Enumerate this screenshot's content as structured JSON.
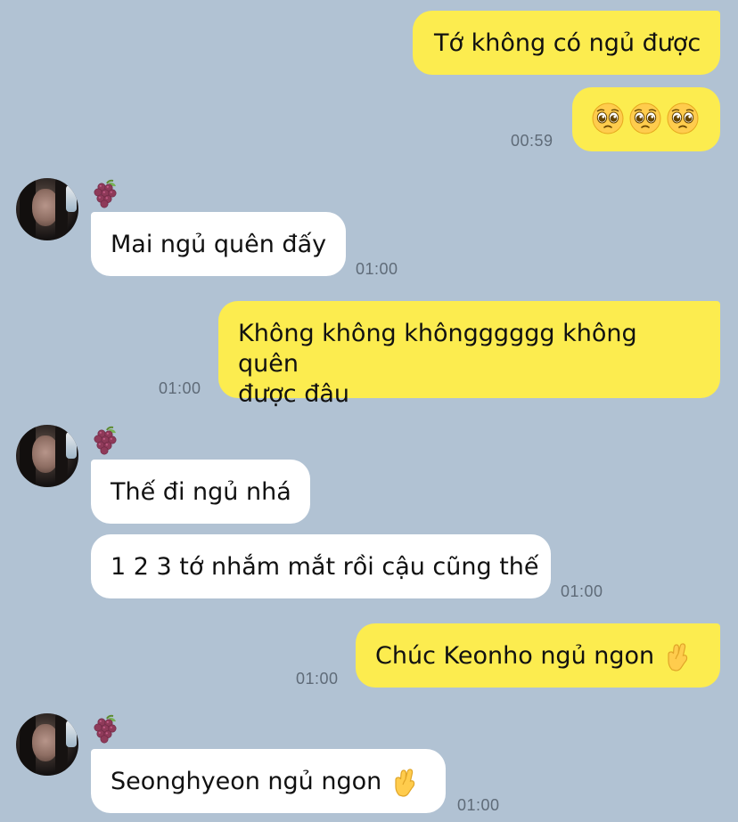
{
  "messages": [
    {
      "side": "me",
      "text": "Tớ không có ngủ được"
    },
    {
      "side": "me",
      "emoji": [
        "pleading-face-icon",
        "pleading-face-icon",
        "pleading-face-icon"
      ],
      "time": "00:59"
    },
    {
      "side": "them",
      "text": "Mai ngủ quên đấy",
      "time": "01:00"
    },
    {
      "side": "me",
      "line1": "Không không khôngggggg không quên",
      "line2": "được đâu",
      "time": "01:00"
    },
    {
      "side": "them",
      "text": "Thế đi ngủ nhá"
    },
    {
      "side": "them",
      "text": "1 2 3 tớ nhắm mắt rồi cậu cũng thế",
      "time": "01:00"
    },
    {
      "side": "me",
      "text": "Chúc Keonho ngủ ngon",
      "emoji": "crossed-fingers-icon",
      "time": "01:00"
    },
    {
      "side": "them",
      "text": "Seonghyeon ngủ ngon",
      "emoji": "crossed-fingers-icon",
      "time": "01:00"
    }
  ],
  "sender": {
    "avatar_icon": "avatar",
    "name_icon": "grapes-icon"
  },
  "colors": {
    "background": "#b1c2d3",
    "my_bubble": "#fcec4f",
    "their_bubble": "#ffffff",
    "timestamp": "#5f6b78"
  }
}
